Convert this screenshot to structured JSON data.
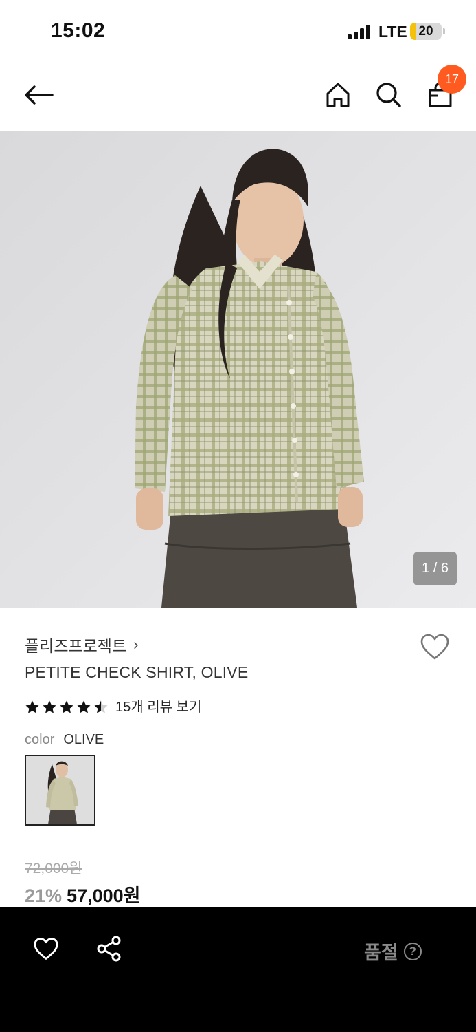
{
  "status_bar": {
    "time": "15:02",
    "network": "LTE",
    "battery_level": "20"
  },
  "header": {
    "back_icon": "arrow-left-icon",
    "home_icon": "home-icon",
    "search_icon": "search-icon",
    "cart_icon": "shopping-bag-icon",
    "cart_count": "17",
    "badge_color": "#ff5a1f"
  },
  "gallery": {
    "counter": "1 / 6",
    "current": 1,
    "total": 6
  },
  "product": {
    "brand": "플리즈프로젝트",
    "brand_chevron": "›",
    "title": "PETITE CHECK SHIRT, OLIVE",
    "rating": 4.5,
    "rating_max": 5,
    "review_link": "15개 리뷰 보기",
    "color_label": "color",
    "color_value": "OLIVE",
    "wish_icon": "heart-outline-icon"
  },
  "price": {
    "original": "72,000원",
    "discount": "21%",
    "sale": "57,000원"
  },
  "bottom_bar": {
    "wish_icon": "heart-outline-icon",
    "share_icon": "share-icon",
    "status": "품절",
    "help_icon": "help-circle-icon",
    "help_glyph": "?"
  }
}
